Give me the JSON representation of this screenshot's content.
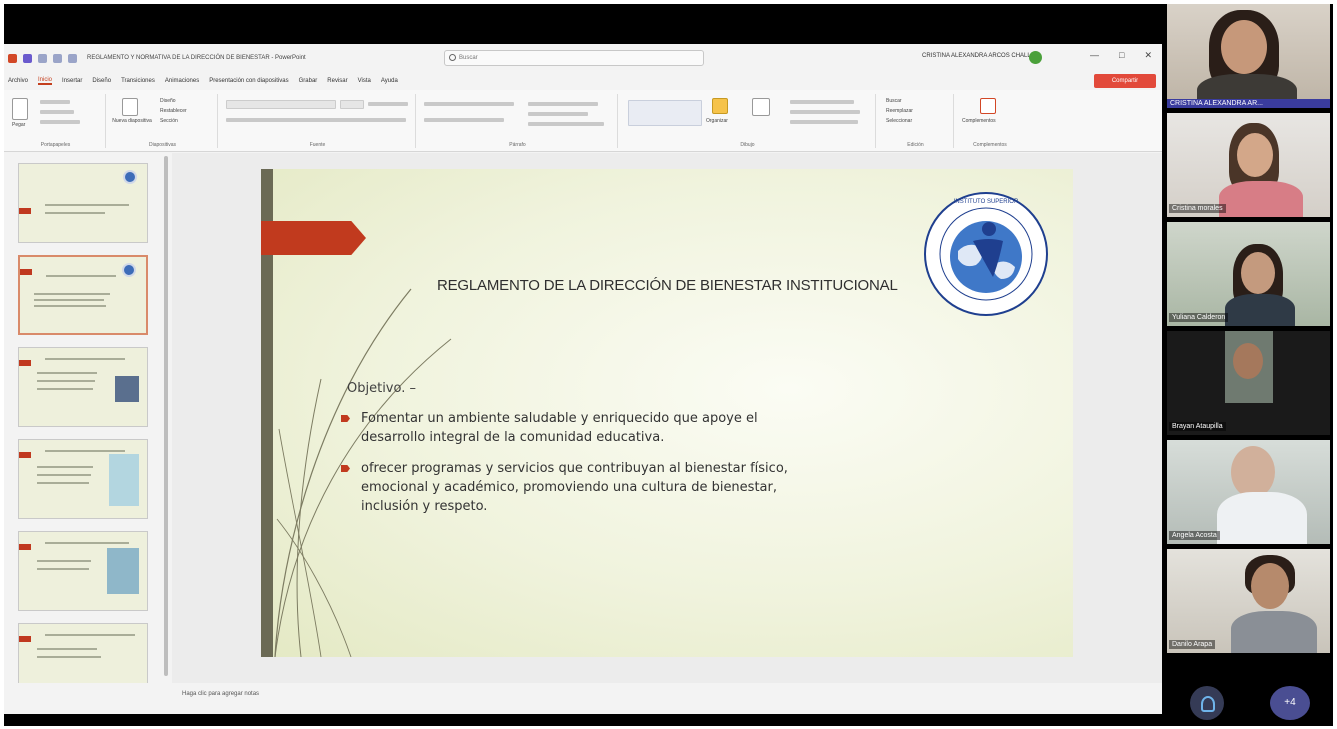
{
  "powerpoint": {
    "doc_title": "REGLAMENTO Y NORMATIVA DE LA DIRECCIÓN DE BIENESTAR - PowerPoint",
    "search_placeholder": "Buscar",
    "user_name": "CRISTINA ALEXANDRA ARCOS CHALLEN",
    "window_controls": [
      "—",
      "□",
      "✕"
    ],
    "menu_tabs": [
      "Archivo",
      "Inicio",
      "Insertar",
      "Diseño",
      "Transiciones",
      "Animaciones",
      "Presentación con diapositivas",
      "Grabar",
      "Revisar",
      "Vista",
      "Ayuda"
    ],
    "active_tab": "Inicio",
    "share_label": "Compartir",
    "ribbon_groups": [
      "Portapapeles",
      "Diapositivas",
      "Fuente",
      "Párrafo",
      "Dibujo",
      "Edición",
      "Complementos"
    ],
    "ribbon_labels": {
      "paste": "Pegar",
      "new_slide": "Nueva diapositiva",
      "layout": "Diseño",
      "reset": "Restablecer",
      "section": "Sección",
      "arrange": "Organizar",
      "find": "Buscar",
      "replace": "Reemplazar",
      "select": "Seleccionar",
      "addins": "Complementos"
    },
    "notes_placeholder": "Haga clic para agregar notas"
  },
  "slide": {
    "title": "REGLAMENTO DE LA DIRECCIÓN DE BIENESTAR INSTITUCIONAL",
    "objective_label": "Objetivo. –",
    "bullets": [
      "Fomentar un ambiente saludable y enriquecido que apoye el desarrollo integral de la comunidad educativa.",
      "ofrecer programas y servicios que contribuyan al bienestar físico, emocional y académico, promoviendo una cultura de bienestar, inclusión y respeto."
    ],
    "logo_text": "INSTITUTO SUPERIOR TECNOLÓGICO NEW GENERATION",
    "accent_color": "#c13a1e"
  },
  "participants": [
    {
      "name": "CRISTINA ALEXANDRA AR..."
    },
    {
      "name": "Cristina morales"
    },
    {
      "name": "Yuliana Calderon"
    },
    {
      "name": "Brayan Ataupilla"
    },
    {
      "name": "Angela Acosta"
    },
    {
      "name": "Danilo Arapa"
    }
  ],
  "call_controls": {
    "more_label": "+4"
  }
}
